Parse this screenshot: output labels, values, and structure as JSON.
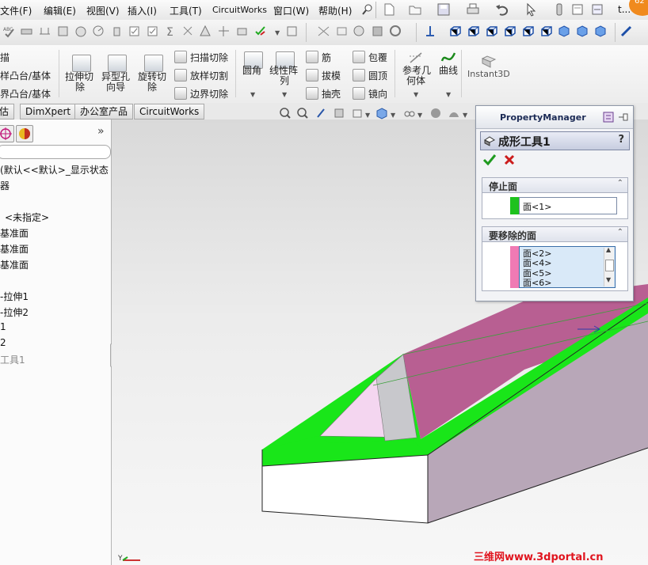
{
  "menu": {
    "items": [
      "文件(F)",
      "编辑(E)",
      "视图(V)",
      "插入(I)",
      "工具(T)",
      "CircuitWorks",
      "窗口(W)",
      "帮助(H)"
    ],
    "more": "t..."
  },
  "notification_badge": "62",
  "command_manager": {
    "left_labels": [
      "描",
      "样凸台/基体",
      "界凸台/基体"
    ],
    "extrude_cut": [
      "拉伸切",
      "除"
    ],
    "hole_wizard": [
      "异型孔",
      "向导"
    ],
    "revolve_cut": [
      "旋转切",
      "除"
    ],
    "sweep_cut": "扫描切除",
    "loft_cut": "放样切割",
    "boundary_cut": "边界切除",
    "fillet": "圆角",
    "linear_pattern": [
      "线性阵",
      "列"
    ],
    "rib": "筋",
    "draft": "拔模",
    "shell": "抽壳",
    "wrap": "包覆",
    "dome": "圆顶",
    "mirror": "镜向",
    "ref_geometry": [
      "参考几",
      "何体"
    ],
    "curves": "曲线",
    "instant3d": "Instant3D"
  },
  "tabs": [
    "估",
    "DimXpert",
    "办公室产品",
    "CircuitWorks"
  ],
  "feature_tree": {
    "items": [
      "(默认<<默认>_显示状态",
      "器",
      "<未指定>",
      "基准面",
      "基准面",
      "基准面",
      "-拉伸1",
      "-拉伸2",
      "1",
      "2",
      "工具1"
    ]
  },
  "property_manager": {
    "title": "PropertyManager",
    "feature_name": "成形工具1",
    "help": "?",
    "stop_face": {
      "title": "停止面",
      "value": "面<1>",
      "color": "#1ec21e"
    },
    "remove_faces": {
      "title": "要移除的面",
      "values": [
        "面<2>",
        "面<4>",
        "面<5>",
        "面<6>"
      ],
      "color": "#f07ab4"
    }
  },
  "model_colors": {
    "top_face": "#19e619",
    "side_face": "#b85f92",
    "front_face": "#ffffff",
    "right_face": "#b8a7b8",
    "tool_face": "#f4d6f0"
  },
  "watermark": "三维网www.3dportal.cn"
}
